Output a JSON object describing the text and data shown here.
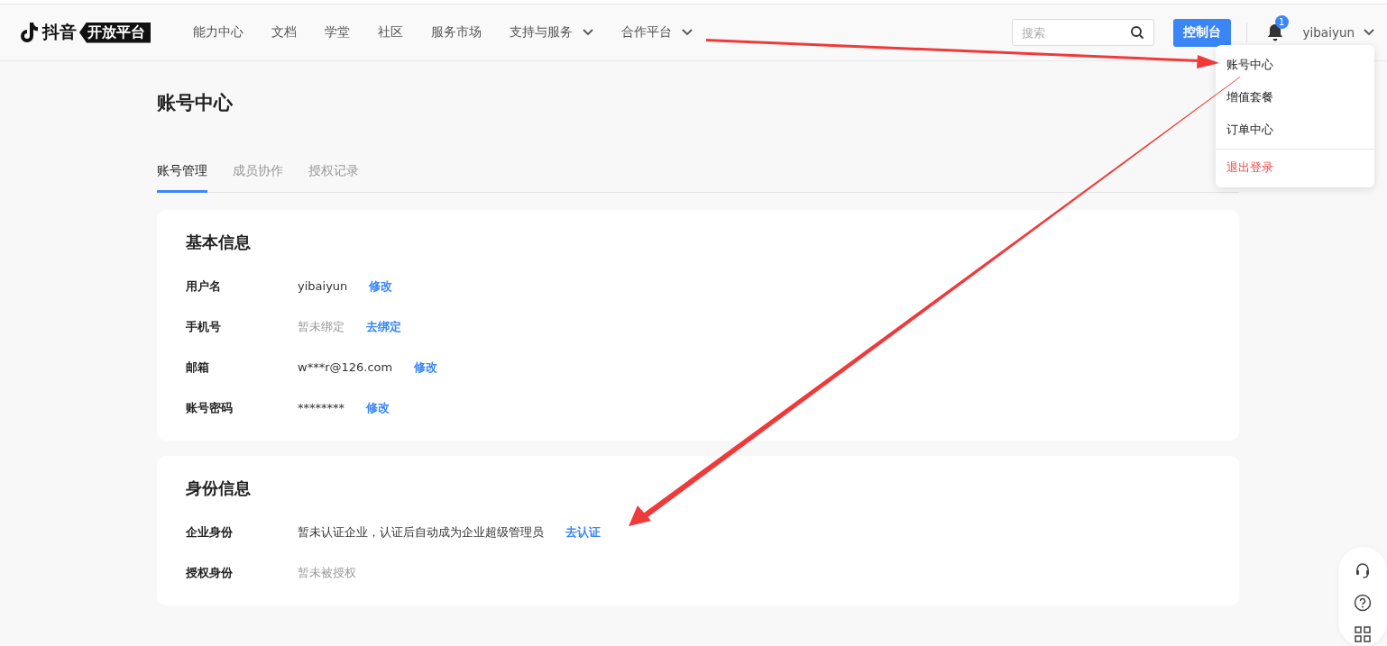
{
  "header": {
    "logo_text": "抖音",
    "logo_badge": "开放平台",
    "nav": [
      {
        "label": "能力中心",
        "dropdown": false
      },
      {
        "label": "文档",
        "dropdown": false
      },
      {
        "label": "学堂",
        "dropdown": false
      },
      {
        "label": "社区",
        "dropdown": false
      },
      {
        "label": "服务市场",
        "dropdown": false
      },
      {
        "label": "支持与服务",
        "dropdown": true
      },
      {
        "label": "合作平台",
        "dropdown": true
      }
    ],
    "search": {
      "placeholder": "搜索"
    },
    "console_button": "控制台",
    "notification_count": "1",
    "username": "yibaiyun"
  },
  "user_menu": {
    "items": [
      {
        "label": "账号中心",
        "kind": "normal"
      },
      {
        "label": "增值套餐",
        "kind": "normal"
      },
      {
        "label": "订单中心",
        "kind": "normal"
      },
      {
        "label": "退出登录",
        "kind": "danger"
      }
    ]
  },
  "page_title": "账号中心",
  "tabs": [
    {
      "label": "账号管理",
      "selected": true
    },
    {
      "label": "成员协作",
      "selected": false
    },
    {
      "label": "授权记录",
      "selected": false
    }
  ],
  "sections": [
    {
      "title": "基本信息",
      "rows": [
        {
          "label": "用户名",
          "value": "yibaiyun",
          "muted": false,
          "action": "修改"
        },
        {
          "label": "手机号",
          "value": "暂未绑定",
          "muted": true,
          "action": "去绑定"
        },
        {
          "label": "邮箱",
          "value": "w***r@126.com",
          "muted": false,
          "action": "修改"
        },
        {
          "label": "账号密码",
          "value": "********",
          "muted": false,
          "action": "修改"
        }
      ]
    },
    {
      "title": "身份信息",
      "rows": [
        {
          "label": "企业身份",
          "value": "暂未认证企业，认证后自动成为企业超级管理员",
          "muted": false,
          "action": "去认证"
        },
        {
          "label": "授权身份",
          "value": "暂未被授权",
          "muted": true
        }
      ]
    }
  ]
}
